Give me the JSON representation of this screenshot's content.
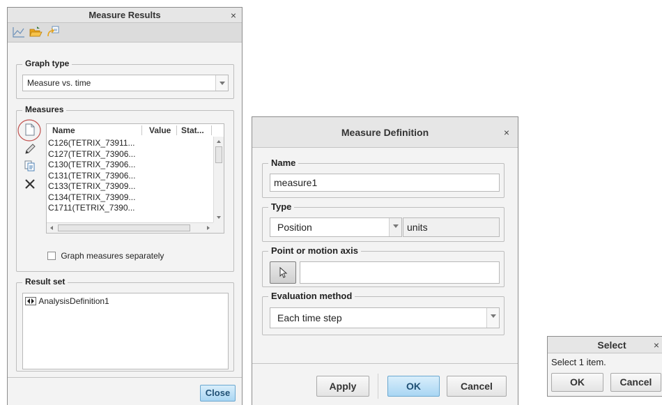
{
  "measure_results": {
    "title": "Measure Results",
    "close_x": "×",
    "graph_type": {
      "label": "Graph type",
      "value": "Measure vs. time"
    },
    "measures": {
      "label": "Measures",
      "columns": [
        "Name",
        "Value",
        "Stat..."
      ],
      "rows": [
        "C126(TETRIX_73911...",
        "C127(TETRIX_73906...",
        "C130(TETRIX_73906...",
        "C131(TETRIX_73906...",
        "C133(TETRIX_73909...",
        "C134(TETRIX_73909...",
        "C1711(TETRIX_7390..."
      ],
      "graph_separately_label": "Graph measures separately",
      "graph_separately_checked": false
    },
    "result_set": {
      "label": "Result set",
      "item": "AnalysisDefinition1"
    },
    "close_button": "Close"
  },
  "measure_definition": {
    "title": "Measure Definition",
    "close_x": "×",
    "name": {
      "label": "Name",
      "value": "measure1"
    },
    "type": {
      "label": "Type",
      "value": "Position",
      "units": "units"
    },
    "point_axis": {
      "label": "Point or motion axis",
      "value": ""
    },
    "evaluation": {
      "label": "Evaluation method",
      "value": "Each time step"
    },
    "buttons": {
      "apply": "Apply",
      "ok": "OK",
      "cancel": "Cancel"
    }
  },
  "select_dialog": {
    "title": "Select",
    "close_x": "×",
    "message": "Select 1 item.",
    "buttons": {
      "ok": "OK",
      "cancel": "Cancel"
    }
  },
  "colors": {
    "highlight_circle": "#c0504d",
    "primary_button": "#a9d6f3",
    "folder_icon": "#e8a317",
    "chart_icon": "#6a8fb8"
  },
  "icons": [
    "chart-icon",
    "open-folder-icon",
    "export-icon",
    "new-measure-icon",
    "edit-pencil-icon",
    "copy-icon",
    "delete-icon",
    "cursor-arrow-icon",
    "expand-arrows-icon"
  ]
}
